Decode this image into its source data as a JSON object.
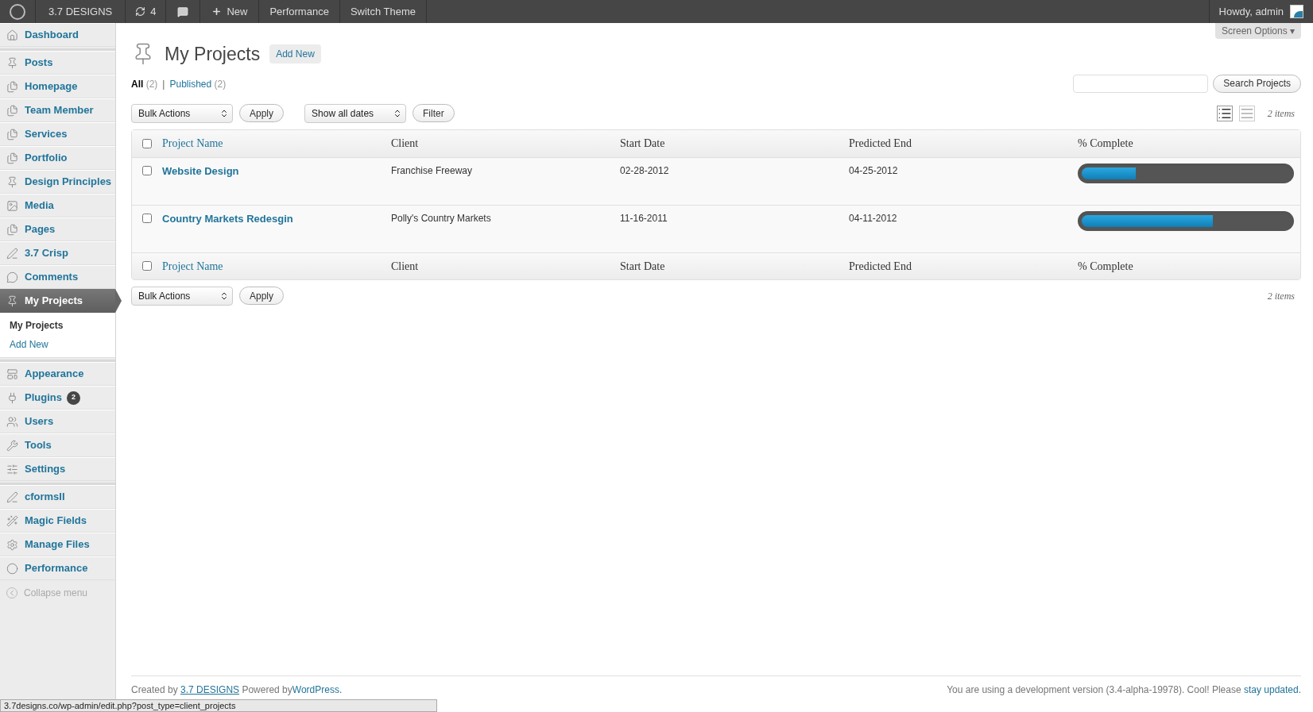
{
  "admin_bar": {
    "site": "3.7 DESIGNS",
    "updates": "4",
    "new": "New",
    "items": [
      "Performance",
      "Switch Theme"
    ],
    "greeting": "Howdy, admin"
  },
  "sidebar": {
    "groups": [
      [
        {
          "label": "Dashboard",
          "selected": false
        }
      ],
      [
        {
          "label": "Posts",
          "selected": false
        },
        {
          "label": "Homepage",
          "selected": false
        },
        {
          "label": "Team Member",
          "selected": false
        },
        {
          "label": "Services",
          "selected": false
        },
        {
          "label": "Portfolio",
          "selected": false
        },
        {
          "label": "Design Principles",
          "selected": false
        },
        {
          "label": "Media",
          "selected": false
        },
        {
          "label": "Pages",
          "selected": false
        },
        {
          "label": "3.7 Crisp",
          "selected": false
        },
        {
          "label": "Comments",
          "selected": false
        },
        {
          "label": "My Projects",
          "selected": true,
          "children": [
            {
              "label": "My Projects",
              "selected": true
            },
            {
              "label": "Add New",
              "selected": false
            }
          ]
        }
      ],
      [
        {
          "label": "Appearance",
          "selected": false
        },
        {
          "label": "Plugins",
          "selected": false,
          "badge": "2"
        },
        {
          "label": "Users",
          "selected": false
        },
        {
          "label": "Tools",
          "selected": false
        },
        {
          "label": "Settings",
          "selected": false
        }
      ],
      [
        {
          "label": "cformsII",
          "selected": false
        },
        {
          "label": "Magic Fields",
          "selected": false
        },
        {
          "label": "Manage Files",
          "selected": false
        },
        {
          "label": "Performance",
          "selected": false
        }
      ]
    ],
    "collapse": "Collapse menu"
  },
  "screen_options": "Screen Options ▾",
  "page": {
    "title": "My Projects",
    "add_new": "Add New"
  },
  "views": [
    {
      "label": "All",
      "count": "(2)",
      "selected": true
    },
    {
      "label": "Published",
      "count": "(2)",
      "selected": false
    }
  ],
  "views_separator": "|",
  "search": {
    "button": "Search Projects"
  },
  "bulk_actions": "Bulk Actions",
  "apply": "Apply",
  "dates": "Show all dates",
  "filter": "Filter",
  "items_count": "2 items",
  "table": {
    "select_all_checked": false,
    "columns": [
      "Project Name",
      "Client",
      "Start Date",
      "Predicted End",
      "% Complete"
    ],
    "rows": [
      {
        "checked": false,
        "name": "Website Design",
        "client": "Franchise Freeway",
        "start": "02-28-2012",
        "end": "04-25-2012",
        "level": 0.26
      },
      {
        "checked": false,
        "name": "Country Markets Redesgin",
        "client": "Polly's Country Markets",
        "start": "11-16-2011",
        "end": "04-11-2012",
        "level": 0.63
      }
    ],
    "footer_select_all_checked": false,
    "footer_columns": [
      "Project Name",
      "Client",
      "Start Date",
      "Predicted End",
      "% Complete"
    ]
  },
  "bottom_bulk_actions": "Bulk Actions",
  "bottom_apply": "Apply",
  "bottom_items_count": "2 items",
  "footer": {
    "left_prefix": "Created by",
    "left_link": "3.7 DESIGNS",
    "left_middle": "Powered by",
    "left_link2": "WordPress.",
    "right_text": "You are using a development version (3.4-alpha-19978). Cool! Please",
    "right_link": "stay updated."
  },
  "status_url": "3.7designs.co/wp-admin/edit.php?post_type=client_projects"
}
